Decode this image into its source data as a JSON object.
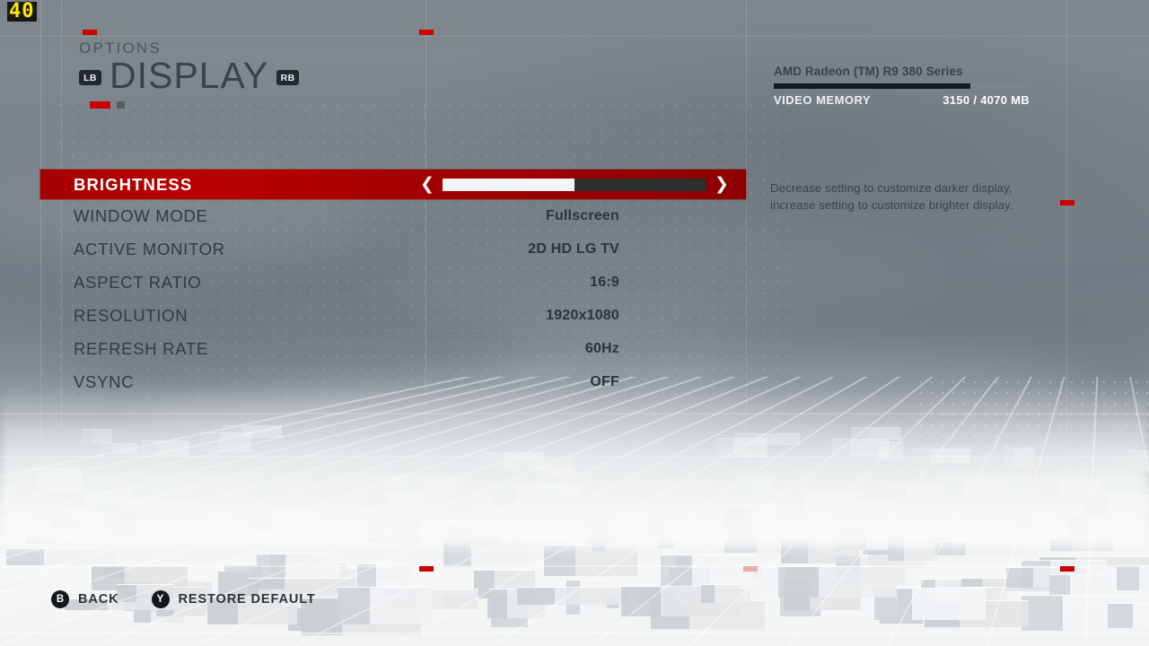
{
  "hud": {
    "fps": "40"
  },
  "header": {
    "kicker": "OPTIONS",
    "title": "DISPLAY",
    "left_bumper": "LB",
    "right_bumper": "RB"
  },
  "gpu_panel": {
    "device_name": "AMD Radeon (TM) R9 380 Series",
    "memory_label": "VIDEO MEMORY",
    "memory_value": "3150 / 4070 MB",
    "memory_used_mb": 3150,
    "memory_total_mb": 4070,
    "memory_percent": 77
  },
  "settings": {
    "brightness": {
      "label": "BRIGHTNESS",
      "selected": true,
      "type": "slider",
      "fill_percent": 50,
      "left_arrow": "❮",
      "right_arrow": "❯"
    },
    "rows": [
      {
        "label": "WINDOW MODE",
        "value": "Fullscreen"
      },
      {
        "label": "ACTIVE MONITOR",
        "value": "2D HD LG TV"
      },
      {
        "label": "ASPECT RATIO",
        "value": "16:9"
      },
      {
        "label": "RESOLUTION",
        "value": "1920x1080"
      },
      {
        "label": "REFRESH RATE",
        "value": "60Hz"
      },
      {
        "label": "VSYNC",
        "value": "OFF"
      }
    ]
  },
  "help": {
    "text": "Decrease setting to customize darker display, increase setting to customize brighter display."
  },
  "footer": {
    "prompts": [
      {
        "button": "B",
        "label": "BACK"
      },
      {
        "button": "Y",
        "label": "RESTORE DEFAULT"
      }
    ]
  },
  "colors": {
    "accent_red": "#b90000",
    "tick_red": "#cc0000",
    "fps_yellow": "#ffe800",
    "text_dark": "#323b43",
    "bumper_bg": "#212830"
  }
}
